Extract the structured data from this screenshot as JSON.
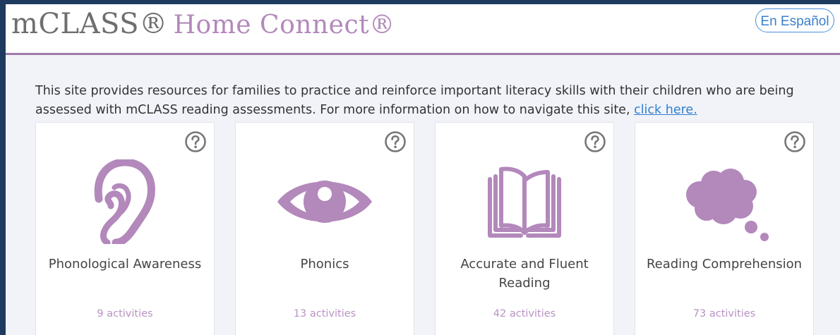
{
  "header": {
    "brand_main": "mCLASS®",
    "brand_sub": "Home Connect®",
    "language_button": "En Español"
  },
  "intro": {
    "text": "This site provides resources for families to practice and reinforce important literacy skills with their children who are being assessed with mCLASS reading assessments. For more information on how to navigate this site, ",
    "link": "click here."
  },
  "cards": [
    {
      "title": "Phonological Awareness",
      "count": "9 activities",
      "icon": "ear-icon"
    },
    {
      "title": "Phonics",
      "count": "13 activities",
      "icon": "eye-icon"
    },
    {
      "title": "Accurate and Fluent Reading",
      "count": "42 activities",
      "icon": "book-icon"
    },
    {
      "title": "Reading Comprehension",
      "count": "73 activities",
      "icon": "thought-cloud-icon"
    }
  ],
  "colors": {
    "accent_purple": "#b388bb",
    "link_blue": "#2f7fd1",
    "frame_navy": "#1e3a5f",
    "page_bg": "#f1f3f8"
  }
}
